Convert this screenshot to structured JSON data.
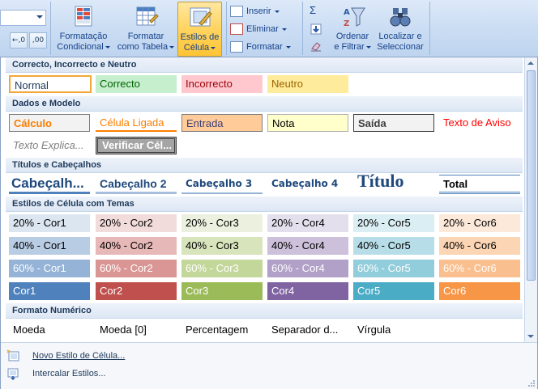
{
  "ribbon": {
    "conditional_format": {
      "line1": "Formatação",
      "line2": "Condicional"
    },
    "format_table": {
      "line1": "Formatar",
      "line2": "como Tabela"
    },
    "cell_styles": {
      "line1": "Estilos de",
      "line2": "Célula"
    },
    "insert_label": "Inserir",
    "delete_label": "Eliminar",
    "format_label": "Formatar",
    "sort_filter": {
      "line1": "Ordenar",
      "line2": "e Filtrar"
    },
    "find_select": {
      "line1": "Localizar e",
      "line2": "Seleccionar"
    },
    "sum_symbol": "Σ",
    "decimal_inc": "←,0 ,00",
    "decimal_dec": ",00 →,0"
  },
  "sections": {
    "good_bad": "Correcto, Incorrecto e Neutro",
    "data_model": "Dados e Modelo",
    "titles": "Títulos e Cabeçalhos",
    "themed": "Estilos de Célula com Temas",
    "number": "Formato Numérico"
  },
  "styles": {
    "good_bad": [
      "Normal",
      "Correcto",
      "Incorrecto",
      "Neutro"
    ],
    "data_model_row1": [
      "Cálculo",
      "Célula Ligada",
      "Entrada",
      "Nota",
      "Saída",
      "Texto de Aviso"
    ],
    "data_model_row2": [
      "Texto Explica...",
      "Verificar Cél..."
    ],
    "titles": [
      "Cabeçalh...",
      "Cabeçalho 2",
      "Cabeçalho 3",
      "Cabeçalho 4",
      "Título",
      "Total"
    ],
    "themed_20": [
      "20% - Cor1",
      "20% - Cor2",
      "20% - Cor3",
      "20% - Cor4",
      "20% - Cor5",
      "20% - Cor6"
    ],
    "themed_40": [
      "40% - Cor1",
      "40% - Cor2",
      "40% - Cor3",
      "40% - Cor4",
      "40% - Cor5",
      "40% - Cor6"
    ],
    "themed_60": [
      "60% - Cor1",
      "60% - Cor2",
      "60% - Cor3",
      "60% - Cor4",
      "60% - Cor5",
      "60% - Cor6"
    ],
    "themed_100": [
      "Cor1",
      "Cor2",
      "Cor3",
      "Cor4",
      "Cor5",
      "Cor6"
    ],
    "number": [
      "Moeda",
      "Moeda [0]",
      "Percentagem",
      "Separador d...",
      "Vírgula"
    ]
  },
  "colors": {
    "good": "#c6efce",
    "good_text": "#006100",
    "bad": "#ffc7ce",
    "bad_text": "#9c0006",
    "neutral": "#ffeb9c",
    "neutral_text": "#9c6500",
    "c20": [
      "#dce6f1",
      "#f2dcdb",
      "#ebf1de",
      "#e4dfec",
      "#daeef3",
      "#fde9d9"
    ],
    "c40": [
      "#b8cce4",
      "#e6b8b7",
      "#d8e4bc",
      "#ccc0da",
      "#b7dee8",
      "#fcd5b4"
    ],
    "c60": [
      "#95b3d7",
      "#da9694",
      "#c4d79b",
      "#b1a0c7",
      "#92cddc",
      "#fabf8f"
    ],
    "c100": [
      "#4f81bd",
      "#c0504d",
      "#9bbb59",
      "#8064a2",
      "#4bacc6",
      "#f79646"
    ]
  },
  "footer": {
    "new_style": "Novo Estilo de Célula...",
    "merge_styles": "Intercalar Estilos..."
  }
}
